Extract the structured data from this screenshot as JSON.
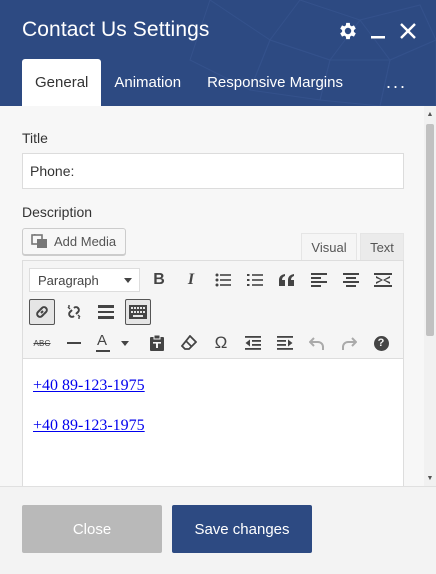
{
  "dialog": {
    "title": "Contact Us Settings",
    "icons": [
      "gear-icon",
      "minimize-icon",
      "close-icon"
    ]
  },
  "tabs": [
    {
      "label": "General",
      "active": true
    },
    {
      "label": "Animation",
      "active": false
    },
    {
      "label": "Responsive Margins",
      "active": false
    },
    {
      "label": "...",
      "active": false
    }
  ],
  "form": {
    "title_label": "Title",
    "title_value": "Phone:",
    "description_label": "Description",
    "add_media_label": "Add Media",
    "mode_visual": "Visual",
    "mode_text": "Text"
  },
  "editor": {
    "format_selected": "Paragraph",
    "content_links": [
      "+40 89-123-1975",
      "+40 89-123-1975"
    ],
    "toolbar_row1": [
      "bold-icon",
      "italic-icon",
      "bullet-list-icon",
      "numbered-list-icon",
      "blockquote-icon",
      "align-left-icon",
      "align-center-icon",
      "align-right-icon"
    ],
    "toolbar_row2": [
      "link-icon",
      "unlink-icon",
      "read-more-icon",
      "toolbar-toggle-icon"
    ],
    "toolbar_row3": [
      "strikethrough-icon",
      "horizontal-line-icon",
      "text-color-icon",
      "paste-as-text-icon",
      "clear-formatting-icon",
      "special-character-icon",
      "outdent-icon",
      "indent-icon",
      "undo-icon",
      "redo-icon",
      "help-icon"
    ],
    "bold_glyph": "B",
    "italic_glyph": "I",
    "strike_glyph": "ABC",
    "omega_glyph": "Ω",
    "help_glyph": "?",
    "textcolor_glyph": "A"
  },
  "footer": {
    "close_label": "Close",
    "save_label": "Save changes"
  },
  "colors": {
    "header": "#2d4a82",
    "save_button": "#2d4a82",
    "close_button": "#b9b9b9",
    "link": "#0000ee"
  }
}
